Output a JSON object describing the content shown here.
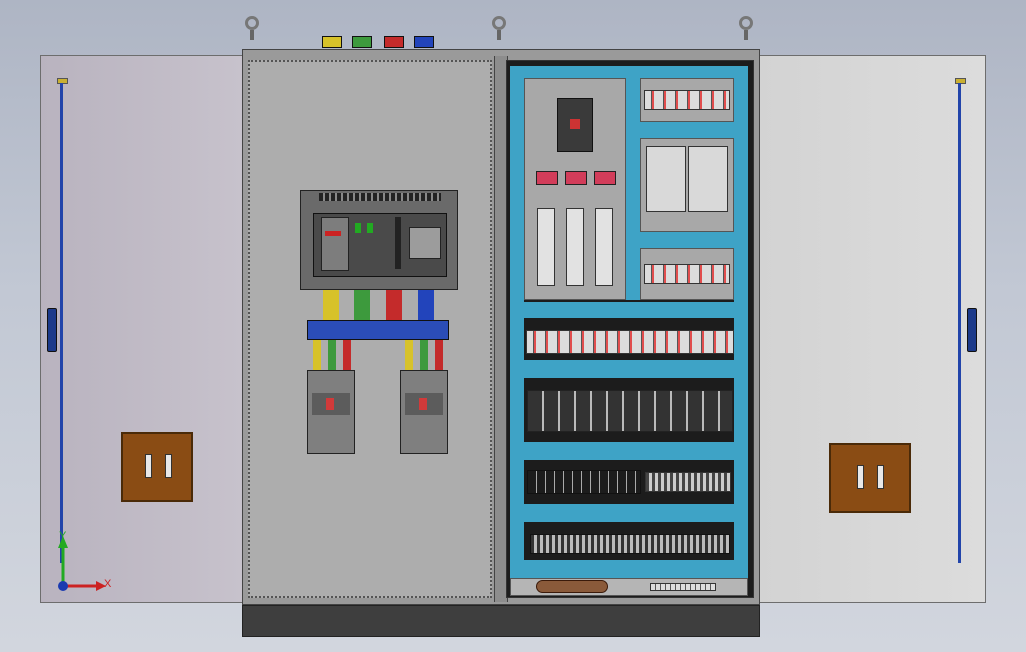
{
  "scene": {
    "axis_labels": {
      "x": "X",
      "y": "Y"
    },
    "phase_colors": [
      "#d7c22a",
      "#3d9a3d",
      "#c42b2b",
      "#2244bb"
    ]
  },
  "colors": {
    "teal_rail": "#3ea3c6",
    "busbar_blue": "#2b4db8",
    "handle_brown": "#8a4c14"
  }
}
